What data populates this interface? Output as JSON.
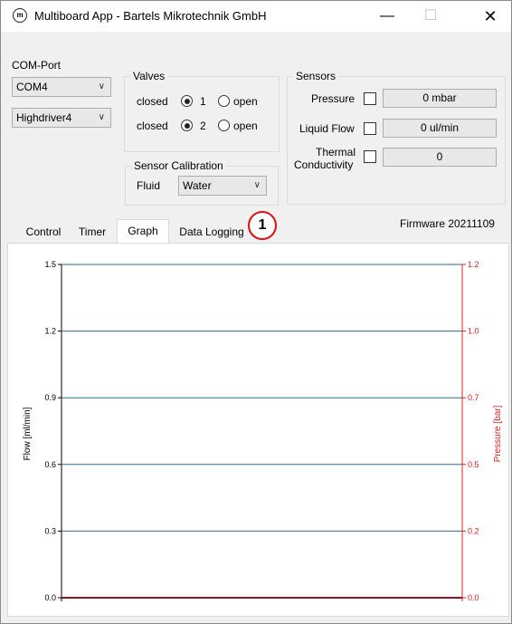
{
  "window": {
    "title": "Multiboard App - Bartels Mikrotechnik GmbH",
    "icon_text": "m",
    "minimize_glyph": "—",
    "maximize_glyph": "☐",
    "close_glyph": "✕"
  },
  "com": {
    "label": "COM-Port",
    "port_value": "COM4",
    "driver_value": "Highdriver4"
  },
  "valves": {
    "title": "Valves",
    "rows": [
      {
        "closed_label": "closed",
        "number": "1",
        "open_label": "open",
        "closed_selected": true
      },
      {
        "closed_label": "closed",
        "number": "2",
        "open_label": "open",
        "closed_selected": true
      }
    ]
  },
  "calibration": {
    "title": "Sensor Calibration",
    "fluid_label": "Fluid",
    "fluid_value": "Water"
  },
  "sensors": {
    "title": "Sensors",
    "pressure_label": "Pressure",
    "pressure_value": "0 mbar",
    "flow_label": "Liquid Flow",
    "flow_value": "0 ul/min",
    "thermal_label_1": "Thermal",
    "thermal_label_2": "Conductivity",
    "thermal_value": "0"
  },
  "tabs": [
    "Control",
    "Timer",
    "Graph",
    "Data Logging"
  ],
  "active_tab": "Graph",
  "firmware": "Firmware 20211109",
  "callout": "1",
  "colors": {
    "flow_axis": "#000000",
    "pressure_axis": "#e02020",
    "gridline": "#2e6b8a",
    "baseline": "#8b1a1a"
  },
  "chart_data": {
    "type": "line",
    "title": "",
    "xlabel": "",
    "ylabel": "Flow [ml/min]",
    "y2label": "Pressure [bar]",
    "ylim": [
      0,
      1.5
    ],
    "y2lim": [
      0,
      1.2
    ],
    "yticks": [
      "1.5",
      "1.2",
      "0.9",
      "0.6",
      "0.3",
      "0.0"
    ],
    "y2ticks": [
      "1.2",
      "1.0",
      "0.7",
      "0.5",
      "0.2",
      "0.0"
    ],
    "grid": true,
    "series": []
  }
}
